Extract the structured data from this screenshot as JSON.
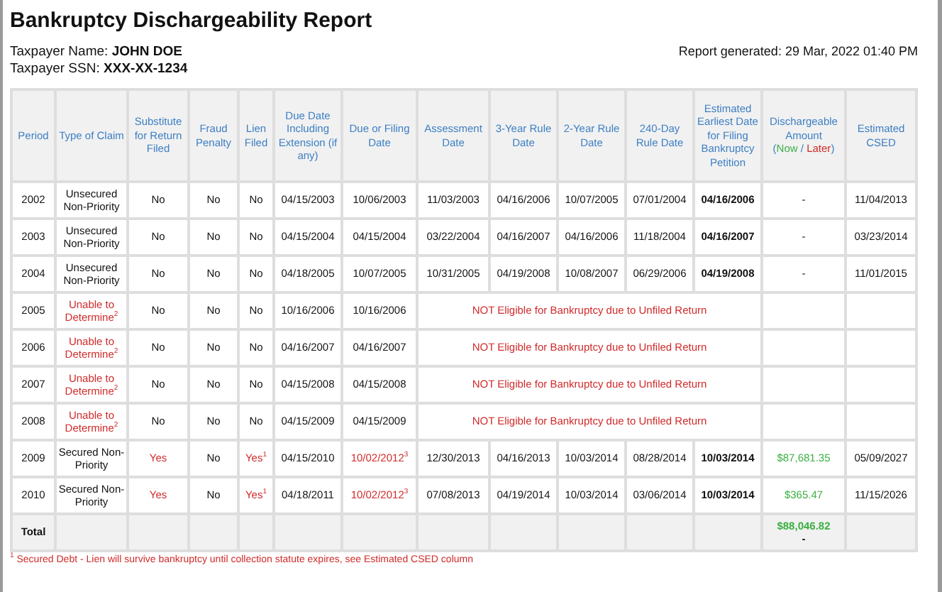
{
  "report": {
    "title": "Bankruptcy Dischargeability Report",
    "generated": "Report generated: 29 Mar, 2022 01:40 PM",
    "taxpayer": [
      {
        "label": "Taxpayer Name:",
        "value": "JOHN DOE"
      },
      {
        "label": "Taxpayer SSN:",
        "value": "XXX-XX-1234"
      }
    ]
  },
  "table": {
    "columns": [
      {
        "label": "Period"
      },
      {
        "label": "Type of Claim"
      },
      {
        "label": "Substitute for Return Filed"
      },
      {
        "label": "Fraud Penalty"
      },
      {
        "label": "Lien Filed"
      },
      {
        "label": "Due Date Including Extension (if any)"
      },
      {
        "label": "Due or Filing Date"
      },
      {
        "label": "Assessment Date"
      },
      {
        "label": "3-Year Rule Date"
      },
      {
        "label": "2-Year Rule Date"
      },
      {
        "label": "240-Day Rule Date"
      },
      {
        "label": "Estimated Earliest Date for Filing Bankruptcy Petition"
      },
      {
        "label": "Dischargeable Amount",
        "legend": [
          {
            "text": "(",
            "color": "#3d7fc4"
          },
          {
            "text": "Now",
            "color": "#3cb043"
          },
          {
            "text": " / ",
            "color": "#3d7fc4"
          },
          {
            "text": "Later",
            "color": "#d12a2a"
          },
          {
            "text": ")",
            "color": "#3d7fc4"
          }
        ]
      },
      {
        "label": "Estimated CSED"
      }
    ],
    "rows": [
      {
        "kind": "assessed",
        "period": "2002",
        "claim_type": {
          "text": "Unsecured Non-Priority",
          "alert": false
        },
        "substitute_return": {
          "text": "No",
          "alert": false
        },
        "fraud_penalty": "No",
        "lien_filed": {
          "text": "No",
          "alert": false
        },
        "due_date_ext": "04/15/2003",
        "due_or_filing": {
          "text": "10/06/2003",
          "alert": false
        },
        "assessment": "11/03/2003",
        "rule_3yr": "04/16/2006",
        "rule_2yr": "10/07/2005",
        "rule_240": "07/01/2004",
        "earliest_filing": "04/16/2006",
        "dischargeable": {
          "text": "-"
        },
        "csed": "11/04/2013"
      },
      {
        "kind": "assessed",
        "period": "2003",
        "claim_type": {
          "text": "Unsecured Non-Priority",
          "alert": false
        },
        "substitute_return": {
          "text": "No",
          "alert": false
        },
        "fraud_penalty": "No",
        "lien_filed": {
          "text": "No",
          "alert": false
        },
        "due_date_ext": "04/15/2004",
        "due_or_filing": {
          "text": "04/15/2004",
          "alert": false
        },
        "assessment": "03/22/2004",
        "rule_3yr": "04/16/2007",
        "rule_2yr": "04/16/2006",
        "rule_240": "11/18/2004",
        "earliest_filing": "04/16/2007",
        "dischargeable": {
          "text": "-"
        },
        "csed": "03/23/2014"
      },
      {
        "kind": "assessed",
        "period": "2004",
        "claim_type": {
          "text": "Unsecured Non-Priority",
          "alert": false
        },
        "substitute_return": {
          "text": "No",
          "alert": false
        },
        "fraud_penalty": "No",
        "lien_filed": {
          "text": "No",
          "alert": false
        },
        "due_date_ext": "04/18/2005",
        "due_or_filing": {
          "text": "10/07/2005",
          "alert": false
        },
        "assessment": "10/31/2005",
        "rule_3yr": "04/19/2008",
        "rule_2yr": "10/08/2007",
        "rule_240": "06/29/2006",
        "earliest_filing": "04/19/2008",
        "dischargeable": {
          "text": "-"
        },
        "csed": "11/01/2015"
      },
      {
        "kind": "unfiled",
        "period": "2005",
        "claim_type": {
          "text": "Unable to Determine",
          "note": "2",
          "alert": true
        },
        "substitute_return": {
          "text": "No",
          "alert": false
        },
        "fraud_penalty": "No",
        "lien_filed": {
          "text": "No",
          "alert": false
        },
        "due_date_ext": "10/16/2006",
        "due_or_filing": {
          "text": "10/16/2006",
          "alert": false
        },
        "message": "NOT Eligible for Bankruptcy due to Unfiled Return"
      },
      {
        "kind": "unfiled",
        "period": "2006",
        "claim_type": {
          "text": "Unable to Determine",
          "note": "2",
          "alert": true
        },
        "substitute_return": {
          "text": "No",
          "alert": false
        },
        "fraud_penalty": "No",
        "lien_filed": {
          "text": "No",
          "alert": false
        },
        "due_date_ext": "04/16/2007",
        "due_or_filing": {
          "text": "04/16/2007",
          "alert": false
        },
        "message": "NOT Eligible for Bankruptcy due to Unfiled Return"
      },
      {
        "kind": "unfiled",
        "period": "2007",
        "claim_type": {
          "text": "Unable to Determine",
          "note": "2",
          "alert": true
        },
        "substitute_return": {
          "text": "No",
          "alert": false
        },
        "fraud_penalty": "No",
        "lien_filed": {
          "text": "No",
          "alert": false
        },
        "due_date_ext": "04/15/2008",
        "due_or_filing": {
          "text": "04/15/2008",
          "alert": false
        },
        "message": "NOT Eligible for Bankruptcy due to Unfiled Return"
      },
      {
        "kind": "unfiled",
        "period": "2008",
        "claim_type": {
          "text": "Unable to Determine",
          "note": "2",
          "alert": true
        },
        "substitute_return": {
          "text": "No",
          "alert": false
        },
        "fraud_penalty": "No",
        "lien_filed": {
          "text": "No",
          "alert": false
        },
        "due_date_ext": "04/15/2009",
        "due_or_filing": {
          "text": "04/15/2009",
          "alert": false
        },
        "message": "NOT Eligible for Bankruptcy due to Unfiled Return"
      },
      {
        "kind": "assessed",
        "period": "2009",
        "claim_type": {
          "text": "Secured Non-Priority",
          "alert": false
        },
        "substitute_return": {
          "text": "Yes",
          "alert": true
        },
        "fraud_penalty": "No",
        "lien_filed": {
          "text": "Yes",
          "note": "1",
          "alert": true
        },
        "due_date_ext": "04/15/2010",
        "due_or_filing": {
          "text": "10/02/2012",
          "note": "3",
          "alert": true
        },
        "assessment": "12/30/2013",
        "rule_3yr": "04/16/2013",
        "rule_2yr": "10/03/2014",
        "rule_240": "08/28/2014",
        "earliest_filing": "10/03/2014",
        "dischargeable": {
          "text": "$87,681.35",
          "color": "#3cb043"
        },
        "csed": "05/09/2027"
      },
      {
        "kind": "assessed",
        "period": "2010",
        "claim_type": {
          "text": "Secured Non-Priority",
          "alert": false
        },
        "substitute_return": {
          "text": "Yes",
          "alert": true
        },
        "fraud_penalty": "No",
        "lien_filed": {
          "text": "Yes",
          "note": "1",
          "alert": true
        },
        "due_date_ext": "04/18/2011",
        "due_or_filing": {
          "text": "10/02/2012",
          "note": "3",
          "alert": true
        },
        "assessment": "07/08/2013",
        "rule_3yr": "04/19/2014",
        "rule_2yr": "10/03/2014",
        "rule_240": "03/06/2014",
        "earliest_filing": "10/03/2014",
        "dischargeable": {
          "text": "$365.47",
          "color": "#3cb043"
        },
        "csed": "11/15/2026"
      }
    ],
    "total": {
      "label": "Total",
      "now": "$88,046.82",
      "later": "-"
    }
  },
  "footnote": {
    "note": "1",
    "text": "Secured Debt - Lien will survive bankruptcy until collection statute expires, see Estimated CSED column"
  }
}
